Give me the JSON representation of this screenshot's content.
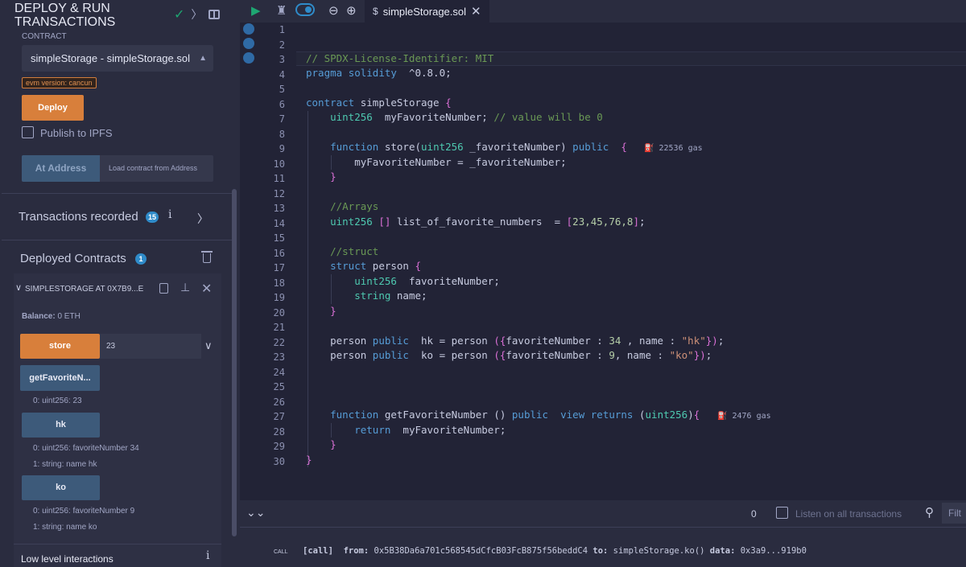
{
  "plugin": {
    "title_line1": "DEPLOY & RUN",
    "title_line2": "TRANSACTIONS",
    "contract_label": "CONTRACT",
    "contract_selected": "simpleStorage - simpleStorage.sol",
    "evm_version": "evm version: cancun",
    "deploy_label": "Deploy",
    "publish_label": "Publish to IPFS",
    "at_address_label": "At Address",
    "load_contract_label": "Load contract from Address",
    "transactions_label": "Transactions recorded",
    "transactions_count": "15",
    "deployed_label": "Deployed Contracts",
    "deployed_count": "1",
    "instance": {
      "title": "SIMPLESTORAGE AT 0X7B9...E",
      "balance_label": "Balance:",
      "balance_value": "0 ETH",
      "functions": [
        {
          "name": "store",
          "input": "23"
        },
        {
          "name": "getFavoriteN...",
          "outputs": [
            "0: uint256: 23"
          ]
        },
        {
          "name": "hk",
          "outputs": [
            "0: uint256: favoriteNumber 34",
            "1: string: name hk"
          ]
        },
        {
          "name": "ko",
          "outputs": [
            "0: uint256: favoriteNumber 9",
            "1: string: name ko"
          ]
        }
      ]
    },
    "low_level_label": "Low level interactions"
  },
  "editor": {
    "tab_filename": "simpleStorage.sol",
    "gas": {
      "store": "22536 gas",
      "getFavoriteNumber": "2476 gas"
    }
  },
  "terminal": {
    "pending_count": "0",
    "listen_label": "Listen on all transactions",
    "filter_placeholder": "Filt",
    "call_badge": "CALL",
    "log_tag": "[call]",
    "log_from_label": "from:",
    "log_from_value": "0x5B38Da6a701c568545dCfcB03FcB875f56beddC4",
    "log_to_label": "to:",
    "log_to_value": "simpleStorage.ko()",
    "log_data_label": "data:",
    "log_data_value": "0x3a9...919b0"
  },
  "colors": {
    "accent_orange": "#d87f3b",
    "accent_blue": "#2f8bc9",
    "success_green": "#1ea672"
  }
}
